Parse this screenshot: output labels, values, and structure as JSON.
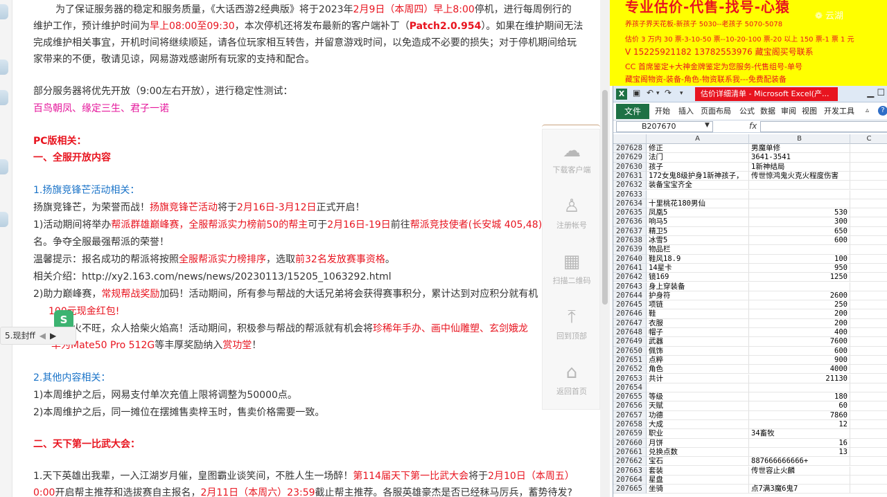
{
  "article": {
    "para1": {
      "l1_a": "为了保证服务器的稳定和服务质量，《大话西游2经典版》将于2023年",
      "l1_b": "2月9日（本周四）早上8:00",
      "l1_c": "停机，进行每周例行的",
      "l2_a": "维护工作，预计维护时间为",
      "l2_b": "早上08:00至09:30",
      "l2_c": "，本次停机还将发布最新的客户端补丁（",
      "l2_d": "Patch2.0.954",
      "l2_e": "）。如果在维护期间无法",
      "l3": "完成维护相关事宜，开机时间将继续顺延，请各位玩家相互转告，并留意游戏时间，以免造成不必要的损失；对于停机期间给玩",
      "l4": "家带来的不便，敬请见谅，网易游戏感谢所有玩家的支持和配合。"
    },
    "para2": {
      "l1": "部分服务器将优先开放（9:00左右开放），进行稳定性测试：",
      "l2": "百鸟朝凤、缘定三生、君子一诺"
    },
    "pc_heading": "PC版相关：",
    "section1": "一、全服开放内容",
    "sub1": "1.扬旗竞锋芒活动相关：",
    "s1": {
      "l1_a": "扬旗竞锋芒，为荣誉而战！",
      "l1_b": "扬旗竞锋芒活动",
      "l1_c": "将于",
      "l1_d": "2月16日-3月12日",
      "l1_e": "正式开启！",
      "l2_a": "1)活动期间将举办",
      "l2_b": "帮派群雄巅峰赛，全服帮派实力榜前50的帮主",
      "l2_c": "可于",
      "l2_d": "2月16日-19日",
      "l2_e": "前往",
      "l2_f": "帮派竞技使者(长安城 405,48)",
      "l3": "名。争夺全服最强帮派的荣誉！",
      "l4_a": "温馨提示：报名成功的帮派将按照",
      "l4_b": "全服帮派实力榜排序",
      "l4_c": "，选取",
      "l4_d": "前32名发放赛事资格",
      "l4_e": "。",
      "l5": "相关介绍：http://xy2.163.com/news/news/20230113/15205_1063292.html",
      "l6_a": "2)助力巅峰赛，",
      "l6_b": "常规帮战奖励",
      "l6_c": "加码！活动期间，所有参与帮战的大话兄弟将会获得赛事积分，累计达到对应积分就有机",
      "l7": "100元现金红包!",
      "l8_a": "柴火不旺，众人拾柴火焰高！活动期间，积极参与帮战的帮派就有机会将",
      "l8_b": "珍稀年手办、画中仙雕塑、玄剑娥龙",
      "l9_a": "华为Mate50 Pro 512G",
      "l9_b": "等丰厚奖励纳入",
      "l9_c": "赏功堂",
      "l9_d": "！"
    },
    "sub2": "2.其他内容相关：",
    "s2": {
      "l1": "1)本周维护之后，网易支付单次充值上限将调整为50000点。",
      "l2": "2)本周维护之后，同一摊位在摆摊售卖梓玉时，售卖价格需要一致。"
    },
    "section2": "二、天下第一比武大会：",
    "s3": {
      "l1_a": "1.天下英雄出我辈，一入江湖岁月催，皇图霸业谈笑间，不胜人生一场醉！",
      "l1_b": "第114届天下第一比武大会",
      "l1_c": "将于",
      "l1_d": "2月10日（本周五）",
      "l2_a": "0:00",
      "l2_b": "开启帮主推荐和选拔赛自主报名，",
      "l2_c": "2月11日（本周六）23:59",
      "l2_d": "截止帮主推荐。各服英雄豪杰是否已经秣马厉兵，蓄势待发?"
    }
  },
  "float_panel": {
    "download": "下载客户端",
    "register": "注册帐号",
    "qrcode": "扫描二维码",
    "top": "回到顶部",
    "home": "返回首页"
  },
  "share_popup": {
    "text": "5.现封ff",
    "prev": "◀",
    "next": "▶",
    "badge": "S"
  },
  "ad": {
    "title": "专业估价-代售-找号-心猿",
    "line1": "养孩子界天花板-新孩子 5030--老孩子 5070-5078",
    "line2": "估价 3 万内 30 票-3-10-50 票--10-20-100 票-20 以上 150 票-1 票 1 元",
    "line3": "V 15225921182      13782553976    藏宝阁买号联系",
    "line4": "CC 首席鉴定+大神金牌鉴定为您服务-代售组号-单号",
    "line5": "藏宝阁物资-装备-角色-物资联系我---免费配装备",
    "watermark": "❁ 云湖"
  },
  "excel": {
    "title": "估价详细清单 - Microsoft Excel(产...",
    "file_tab": "文件",
    "tabs": [
      "开始",
      "插入",
      "页面布局",
      "公式",
      "数据",
      "审阅",
      "视图",
      "开发工具"
    ],
    "name_box": "B207670",
    "fx": "fx",
    "columns": [
      "A",
      "B",
      "C"
    ],
    "rows": [
      {
        "n": "207628",
        "a": "修正",
        "b": "男魔单修",
        "num": false
      },
      {
        "n": "207629",
        "a": "法门",
        "b": "3641-3541",
        "num": false
      },
      {
        "n": "207630",
        "a": "孩子",
        "b": "1新神结局",
        "num": false
      },
      {
        "n": "207631",
        "a": "172女鬼8级护身1新神孩子，",
        "b": "传世惊鸿鬼火克火程度伤害",
        "num": false
      },
      {
        "n": "207632",
        "a": "装备宝宝齐全",
        "b": "",
        "num": false
      },
      {
        "n": "207633",
        "a": "",
        "b": "",
        "num": false
      },
      {
        "n": "207634",
        "a": "十里桃花180男仙",
        "b": "",
        "num": false
      },
      {
        "n": "207635",
        "a": "凤凰5",
        "b": "530",
        "num": true
      },
      {
        "n": "207636",
        "a": "响马5",
        "b": "300",
        "num": true
      },
      {
        "n": "207637",
        "a": "精卫5",
        "b": "650",
        "num": true
      },
      {
        "n": "207638",
        "a": "冰雪5",
        "b": "600",
        "num": true
      },
      {
        "n": "207639",
        "a": "物品栏",
        "b": "",
        "num": false
      },
      {
        "n": "207640",
        "a": "鞋风18.9",
        "b": "100",
        "num": true
      },
      {
        "n": "207641",
        "a": "14星卡",
        "b": "950",
        "num": true
      },
      {
        "n": "207642",
        "a": "镜169",
        "b": "1250",
        "num": true
      },
      {
        "n": "207643",
        "a": "身上穿装备",
        "b": "",
        "num": false
      },
      {
        "n": "207644",
        "a": "护身符",
        "b": "2600",
        "num": true
      },
      {
        "n": "207645",
        "a": "项链",
        "b": "250",
        "num": true
      },
      {
        "n": "207646",
        "a": "鞋",
        "b": "200",
        "num": true
      },
      {
        "n": "207647",
        "a": "衣服",
        "b": "200",
        "num": true
      },
      {
        "n": "207648",
        "a": "帽子",
        "b": "400",
        "num": true
      },
      {
        "n": "207649",
        "a": "武器",
        "b": "7600",
        "num": true
      },
      {
        "n": "207650",
        "a": "佩饰",
        "b": "600",
        "num": true
      },
      {
        "n": "207651",
        "a": "点粹",
        "b": "900",
        "num": true
      },
      {
        "n": "207652",
        "a": "角色",
        "b": "4000",
        "num": true
      },
      {
        "n": "207653",
        "a": "共计",
        "b": "21130",
        "num": true
      },
      {
        "n": "207654",
        "a": "",
        "b": "",
        "num": false
      },
      {
        "n": "207655",
        "a": "等级",
        "b": "180",
        "num": true
      },
      {
        "n": "207656",
        "a": "天赋",
        "b": "60",
        "num": true
      },
      {
        "n": "207657",
        "a": "功德",
        "b": "7860",
        "num": true
      },
      {
        "n": "207658",
        "a": "大成",
        "b": "12",
        "num": true
      },
      {
        "n": "207659",
        "a": "职业",
        "b": "34畜牧",
        "num": false
      },
      {
        "n": "207660",
        "a": "月饼",
        "b": "16",
        "num": true
      },
      {
        "n": "207661",
        "a": "兑换点数",
        "b": "13",
        "num": true
      },
      {
        "n": "207662",
        "a": "宝石",
        "b": "887666666666+",
        "num": false
      },
      {
        "n": "207663",
        "a": "套装",
        "b": "传世容止火麟",
        "num": false
      },
      {
        "n": "207664",
        "a": "星盘",
        "b": "",
        "num": false
      },
      {
        "n": "207665",
        "a": "坐骑",
        "b": "点7满3魔6鬼7",
        "num": false
      }
    ]
  },
  "colors": {
    "accent_red": "#e8141f",
    "link_blue": "#1a73c8",
    "server_pink": "#e5169b",
    "ad_yellow": "#ffff00",
    "excel_green": "#1e7145"
  }
}
